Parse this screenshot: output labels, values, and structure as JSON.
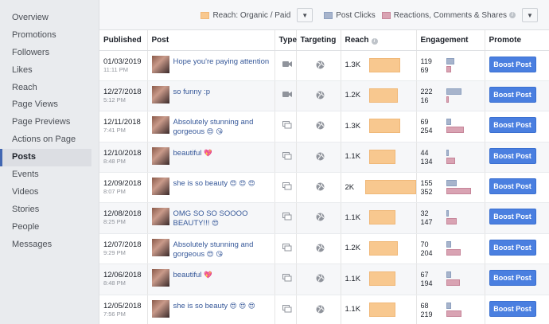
{
  "sidebar": {
    "items": [
      {
        "label": "Overview",
        "active": false
      },
      {
        "label": "Promotions",
        "active": false
      },
      {
        "label": "Followers",
        "active": false
      },
      {
        "label": "Likes",
        "active": false
      },
      {
        "label": "Reach",
        "active": false
      },
      {
        "label": "Page Views",
        "active": false
      },
      {
        "label": "Page Previews",
        "active": false
      },
      {
        "label": "Actions on Page",
        "active": false
      },
      {
        "label": "Posts",
        "active": true
      },
      {
        "label": "Events",
        "active": false
      },
      {
        "label": "Videos",
        "active": false
      },
      {
        "label": "Stories",
        "active": false
      },
      {
        "label": "People",
        "active": false
      },
      {
        "label": "Messages",
        "active": false
      }
    ]
  },
  "legend": {
    "reach_label": "Reach: Organic / Paid",
    "clicks_label": "Post Clicks",
    "reactions_label": "Reactions, Comments & Shares",
    "reach_color": "#f8c88f",
    "clicks_color": "#a7b4cc",
    "reactions_color": "#d9a3b3"
  },
  "table": {
    "headers": {
      "published": "Published",
      "post": "Post",
      "type": "Type",
      "targeting": "Targeting",
      "reach": "Reach",
      "engagement": "Engagement",
      "promote": "Promote"
    },
    "boost_label": "Boost Post",
    "rows": [
      {
        "date": "01/03/2019",
        "time": "11:11 PM",
        "text": "Hope you're paying attention",
        "emoji": "",
        "type": "video",
        "reach": "1.3K",
        "reach_fraction": 0.52,
        "clicks": "119",
        "reactions": "69",
        "clicks_fraction": 0.3,
        "reactions_fraction": 0.17
      },
      {
        "date": "12/27/2018",
        "time": "5:12 PM",
        "text": "so funny :p",
        "emoji": "",
        "type": "video",
        "reach": "1.2K",
        "reach_fraction": 0.49,
        "clicks": "222",
        "reactions": "16",
        "clicks_fraction": 0.53,
        "reactions_fraction": 0.05
      },
      {
        "date": "12/11/2018",
        "time": "7:41 PM",
        "text": "Absolutely stunning and gorgeous",
        "emoji": "😍 😘",
        "type": "album",
        "reach": "1.3K",
        "reach_fraction": 0.52,
        "clicks": "69",
        "reactions": "254",
        "clicks_fraction": 0.17,
        "reactions_fraction": 0.63
      },
      {
        "date": "12/10/2018",
        "time": "8:48 PM",
        "text": "beautiful",
        "emoji": "💖",
        "type": "album",
        "reach": "1.1K",
        "reach_fraction": 0.45,
        "clicks": "44",
        "reactions": "134",
        "clicks_fraction": 0.1,
        "reactions_fraction": 0.33
      },
      {
        "date": "12/09/2018",
        "time": "8:07 PM",
        "text": "she is so beauty",
        "emoji": "😍 😍 😍",
        "type": "album",
        "reach": "2K",
        "reach_fraction": 1.0,
        "clicks": "155",
        "reactions": "352",
        "clicks_fraction": 0.38,
        "reactions_fraction": 0.88
      },
      {
        "date": "12/08/2018",
        "time": "8:25 PM",
        "text": "OMG SO SO SOOOO BEAUTY!!!",
        "emoji": "😍",
        "type": "album",
        "reach": "1.1K",
        "reach_fraction": 0.45,
        "clicks": "32",
        "reactions": "147",
        "clicks_fraction": 0.07,
        "reactions_fraction": 0.37
      },
      {
        "date": "12/07/2018",
        "time": "9:29 PM",
        "text": "Absolutely stunning and gorgeous",
        "emoji": "😍 😘",
        "type": "album",
        "reach": "1.2K",
        "reach_fraction": 0.49,
        "clicks": "70",
        "reactions": "204",
        "clicks_fraction": 0.17,
        "reactions_fraction": 0.5
      },
      {
        "date": "12/06/2018",
        "time": "8:48 PM",
        "text": "beautiful",
        "emoji": "💖",
        "type": "album",
        "reach": "1.1K",
        "reach_fraction": 0.45,
        "clicks": "67",
        "reactions": "194",
        "clicks_fraction": 0.17,
        "reactions_fraction": 0.48
      },
      {
        "date": "12/05/2018",
        "time": "7:56 PM",
        "text": "she is so beauty",
        "emoji": "😍 😍 😍",
        "type": "album",
        "reach": "1.1K",
        "reach_fraction": 0.45,
        "clicks": "68",
        "reactions": "219",
        "clicks_fraction": 0.17,
        "reactions_fraction": 0.54
      }
    ]
  }
}
